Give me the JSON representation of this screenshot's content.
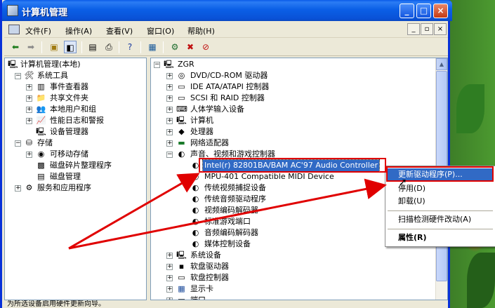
{
  "window": {
    "title": "计算机管理",
    "min": "_",
    "max": "□",
    "close": "×"
  },
  "menubar": {
    "items": [
      "文件(F)",
      "操作(A)",
      "查看(V)",
      "窗口(O)",
      "帮助(H)"
    ],
    "mdi": [
      "_",
      "▫",
      "×"
    ]
  },
  "toolbar": {
    "icons": [
      "back-icon",
      "forward-icon",
      "up-folder-icon",
      "show-tree-icon",
      "properties-icon",
      "print-icon",
      "help-icon",
      "monitor-icon",
      "scan-icon",
      "uninstall-icon",
      "disable-icon"
    ]
  },
  "left_tree": [
    {
      "label": "计算机管理(本地)",
      "level": 0,
      "exp": ""
    },
    {
      "label": "系统工具",
      "level": 1,
      "exp": "−"
    },
    {
      "label": "事件查看器",
      "level": 2,
      "exp": "+"
    },
    {
      "label": "共享文件夹",
      "level": 2,
      "exp": "+"
    },
    {
      "label": "本地用户和组",
      "level": 2,
      "exp": "+"
    },
    {
      "label": "性能日志和警报",
      "level": 2,
      "exp": "+"
    },
    {
      "label": "设备管理器",
      "level": 2,
      "exp": ""
    },
    {
      "label": "存储",
      "level": 1,
      "exp": "−"
    },
    {
      "label": "可移动存储",
      "level": 2,
      "exp": "+"
    },
    {
      "label": "磁盘碎片整理程序",
      "level": 2,
      "exp": ""
    },
    {
      "label": "磁盘管理",
      "level": 2,
      "exp": ""
    },
    {
      "label": "服务和应用程序",
      "level": 1,
      "exp": "+"
    }
  ],
  "right_tree": [
    {
      "label": "ZGR",
      "level": 0,
      "exp": "−"
    },
    {
      "label": "DVD/CD-ROM 驱动器",
      "level": 1,
      "exp": "+"
    },
    {
      "label": "IDE ATA/ATAPI 控制器",
      "level": 1,
      "exp": "+"
    },
    {
      "label": "SCSI 和 RAID 控制器",
      "level": 1,
      "exp": "+"
    },
    {
      "label": "人体学输入设备",
      "level": 1,
      "exp": "+"
    },
    {
      "label": "计算机",
      "level": 1,
      "exp": "+"
    },
    {
      "label": "处理器",
      "level": 1,
      "exp": "+"
    },
    {
      "label": "网络适配器",
      "level": 1,
      "exp": "+"
    },
    {
      "label": "声音、视频和游戏控制器",
      "level": 1,
      "exp": "−"
    },
    {
      "label": "Intel(r) 82801BA/BAM AC'97 Audio Controller",
      "level": 2,
      "exp": "",
      "selected": true
    },
    {
      "label": "MPU-401 Compatible MIDI Device",
      "level": 2,
      "exp": ""
    },
    {
      "label": "传统视频捕捉设备",
      "level": 2,
      "exp": ""
    },
    {
      "label": "传统音频驱动程序",
      "level": 2,
      "exp": ""
    },
    {
      "label": "视频编码解码器",
      "level": 2,
      "exp": ""
    },
    {
      "label": "标准游戏端口",
      "level": 2,
      "exp": ""
    },
    {
      "label": "音频编码解码器",
      "level": 2,
      "exp": ""
    },
    {
      "label": "媒体控制设备",
      "level": 2,
      "exp": ""
    },
    {
      "label": "系统设备",
      "level": 1,
      "exp": "+"
    },
    {
      "label": "软盘驱动器",
      "level": 1,
      "exp": "+"
    },
    {
      "label": "软盘控制器",
      "level": 1,
      "exp": "+"
    },
    {
      "label": "显示卡",
      "level": 1,
      "exp": "+"
    },
    {
      "label": "端口",
      "level": 1,
      "exp": "+"
    }
  ],
  "context_menu": {
    "items": [
      "更新驱动程序(P)...",
      "停用(D)",
      "卸载(U)",
      "扫描检测硬件改动(A)",
      "属性(R)"
    ]
  },
  "status": {
    "text": "为所选设备启用硬件更新向导。"
  },
  "colors": {
    "annotation_red": "#e00000",
    "selection_blue": "#316ac5",
    "title_blue": "#0a5ae8"
  }
}
